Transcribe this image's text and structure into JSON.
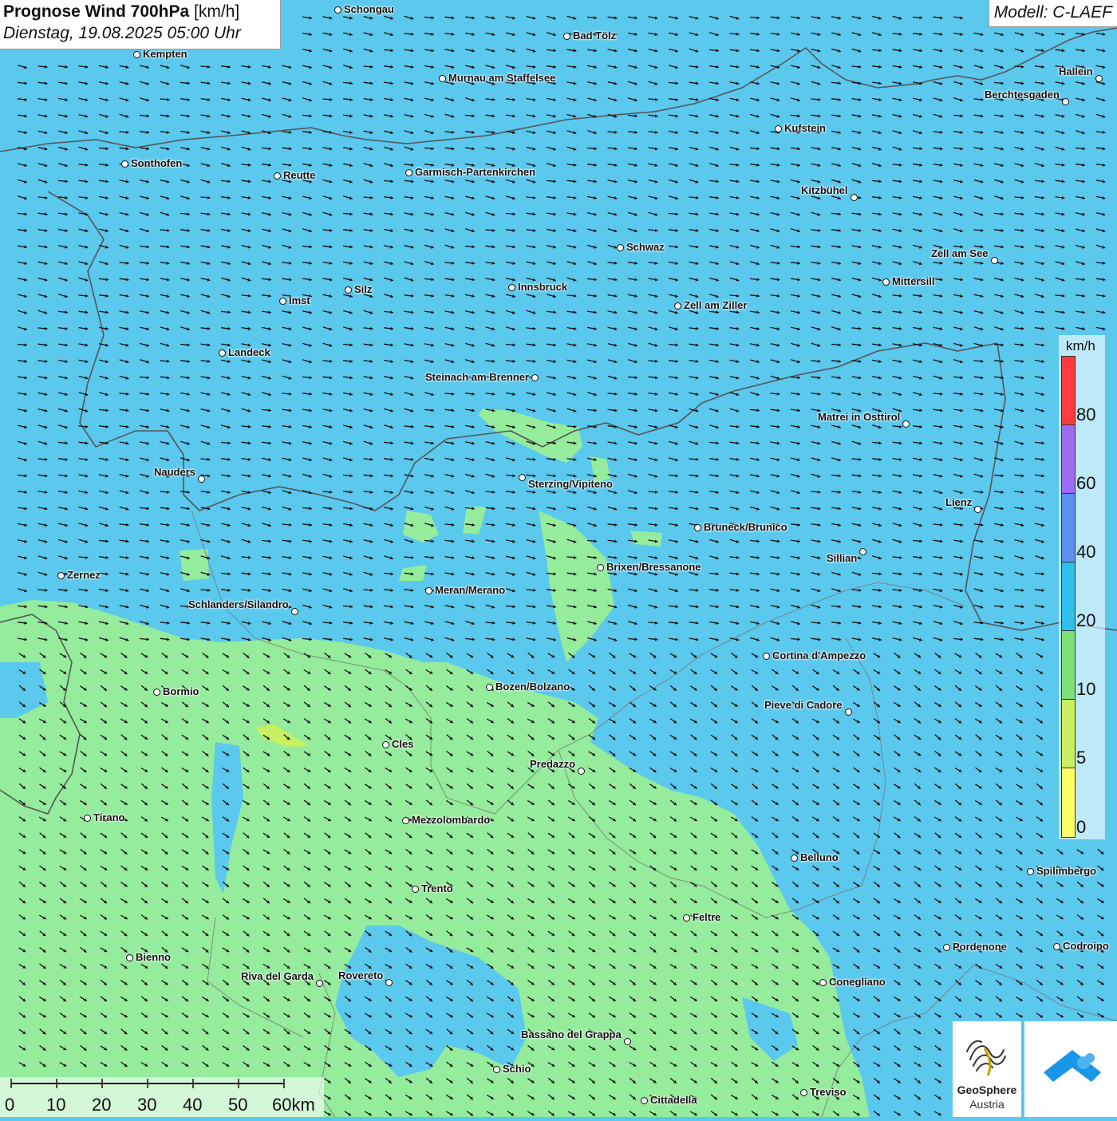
{
  "header": {
    "title_bold": "Prognose Wind 700hPa",
    "title_unit": "[km/h]",
    "date": "Dienstag, 19.08.2025 05:00 Uhr"
  },
  "model": "Modell: C-LAEF",
  "legend": {
    "unit": "km/h",
    "ticks": [
      "80",
      "60",
      "40",
      "20",
      "10",
      "5",
      "0"
    ],
    "colors": [
      "#ff3b3b",
      "#9b6cf0",
      "#5c8ff0",
      "#2fbfe8",
      "#7fe07a",
      "#c8f060",
      "#ffff66"
    ]
  },
  "scale_bar": {
    "labels": [
      "0",
      "10",
      "20",
      "30",
      "40",
      "50",
      "60km"
    ]
  },
  "cities": [
    "Schongau",
    "Bad Tölz",
    "Kempten",
    "Murnau am Staffelsee",
    "Hallein",
    "Berchtesgaden",
    "Kufstein",
    "Sonthofen",
    "Reutte",
    "Garmisch-Partenkirchen",
    "Kitzbühel",
    "Schwaz",
    "Zell am See",
    "Mittersill",
    "Innsbruck",
    "Silz",
    "Imst",
    "Zell am Ziller",
    "Landeck",
    "Steinach am Brenner",
    "Matrei in Osttirol",
    "Nauders",
    "Sterzing/Vipiteno",
    "Lienz",
    "Bruneck/Brunico",
    "Sillian",
    "Zernez",
    "Brixen/Bressanone",
    "Meran/Merano",
    "Schlanders/Silandro",
    "Cortina d'Ampezzo",
    "Bormio",
    "Bozen/Bolzano",
    "Pieve di Cadore",
    "Cles",
    "Predazzo",
    "Tirano",
    "Mezzolombardo",
    "Belluno",
    "Spilimbergo",
    "Trento",
    "Feltre",
    "Bienno",
    "Pordenone",
    "Codroipo",
    "Riva del Garda",
    "Rovereto",
    "Conegliano",
    "Bassano del Grappa",
    "Schio",
    "Treviso",
    "Cittadella"
  ],
  "logos": {
    "left_name": "GeoSphere",
    "left_sub": "Austria"
  },
  "colors": {
    "sea_wind_20_40": "#5bc8ee",
    "wind_10_20": "#94ec9c"
  }
}
